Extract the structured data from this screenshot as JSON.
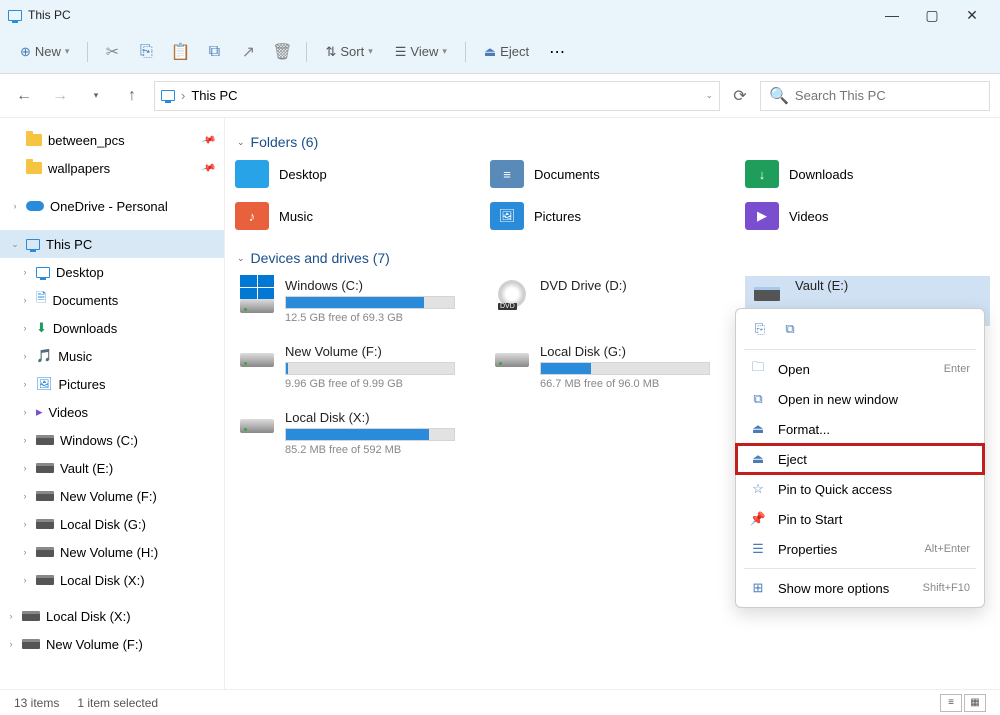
{
  "titlebar": {
    "title": "This PC"
  },
  "toolbar": {
    "new_label": "New",
    "sort_label": "Sort",
    "view_label": "View",
    "eject_label": "Eject"
  },
  "navbar": {
    "breadcrumb": "This PC",
    "search_placeholder": "Search This PC"
  },
  "sidebar": {
    "quick": [
      {
        "label": "between_pcs",
        "pinned": true
      },
      {
        "label": "wallpapers",
        "pinned": true
      }
    ],
    "onedrive_label": "OneDrive - Personal",
    "thispc_label": "This PC",
    "thispc_items": [
      "Desktop",
      "Documents",
      "Downloads",
      "Music",
      "Pictures",
      "Videos",
      "Windows (C:)",
      "Vault (E:)",
      "New Volume (F:)",
      "Local Disk (G:)",
      "New Volume (H:)",
      "Local Disk (X:)"
    ],
    "extra": [
      "Local Disk (X:)",
      "New Volume (F:)"
    ]
  },
  "sections": {
    "folders_label": "Folders (6)",
    "drives_label": "Devices and drives (7)"
  },
  "folders": [
    {
      "label": "Desktop",
      "color": "#29a3e8"
    },
    {
      "label": "Documents",
      "color": "#5a8bb8"
    },
    {
      "label": "Downloads",
      "color": "#1e9e5a"
    },
    {
      "label": "Music",
      "color": "#e8613c"
    },
    {
      "label": "Pictures",
      "color": "#2a8bdb"
    },
    {
      "label": "Videos",
      "color": "#7a4fcf"
    }
  ],
  "drives": [
    {
      "name": "Windows (C:)",
      "free": "12.5 GB free of 69.3 GB",
      "fill": 82,
      "type": "win"
    },
    {
      "name": "DVD Drive (D:)",
      "free": "",
      "fill": 0,
      "type": "dvd"
    },
    {
      "name": "Vault (E:)",
      "free": "",
      "fill": 0,
      "type": "vault",
      "selected": true
    },
    {
      "name": "New Volume (F:)",
      "free": "9.96 GB free of 9.99 GB",
      "fill": 1,
      "type": "hdd"
    },
    {
      "name": "Local Disk (G:)",
      "free": "66.7 MB free of 96.0 MB",
      "fill": 30,
      "type": "hdd"
    },
    {
      "name": "",
      "free": "",
      "fill": 0,
      "type": "empty"
    },
    {
      "name": "Local Disk (X:)",
      "free": "85.2 MB free of 592 MB",
      "fill": 85,
      "type": "hdd"
    }
  ],
  "context_menu": {
    "items": [
      {
        "label": "Open",
        "hint": "Enter",
        "icon": "open"
      },
      {
        "label": "Open in new window",
        "hint": "",
        "icon": "newwin"
      },
      {
        "label": "Format...",
        "hint": "",
        "icon": "format"
      },
      {
        "label": "Eject",
        "hint": "",
        "icon": "eject",
        "highlight": true
      },
      {
        "label": "Pin to Quick access",
        "hint": "",
        "icon": "star"
      },
      {
        "label": "Pin to Start",
        "hint": "",
        "icon": "pin"
      },
      {
        "label": "Properties",
        "hint": "Alt+Enter",
        "icon": "props"
      },
      {
        "label": "Show more options",
        "hint": "Shift+F10",
        "icon": "more",
        "sep_before": true
      }
    ]
  },
  "statusbar": {
    "items_count": "13 items",
    "selected_count": "1 item selected"
  }
}
